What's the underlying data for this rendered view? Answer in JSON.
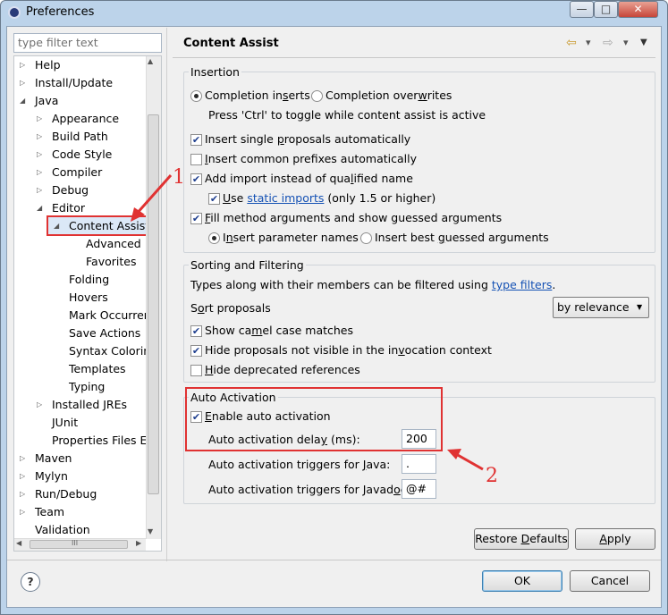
{
  "window": {
    "title": "Preferences",
    "min_glyph": "—",
    "max_glyph": "□",
    "close_glyph": "✕"
  },
  "left": {
    "filter_placeholder": "type filter text",
    "tree": [
      {
        "label": "Help",
        "level": 0,
        "arrow": "▷"
      },
      {
        "label": "Install/Update",
        "level": 0,
        "arrow": "▷"
      },
      {
        "label": "Java",
        "level": 0,
        "arrow": "◢"
      },
      {
        "label": "Appearance",
        "level": 1,
        "arrow": "▷"
      },
      {
        "label": "Build Path",
        "level": 1,
        "arrow": "▷"
      },
      {
        "label": "Code Style",
        "level": 1,
        "arrow": "▷"
      },
      {
        "label": "Compiler",
        "level": 1,
        "arrow": "▷"
      },
      {
        "label": "Debug",
        "level": 1,
        "arrow": "▷"
      },
      {
        "label": "Editor",
        "level": 1,
        "arrow": "◢"
      },
      {
        "label": "Content Assist",
        "level": 2,
        "arrow": "◢",
        "selected": true
      },
      {
        "label": "Advanced",
        "level": 3,
        "arrow": ""
      },
      {
        "label": "Favorites",
        "level": 3,
        "arrow": ""
      },
      {
        "label": "Folding",
        "level": 2,
        "arrow": ""
      },
      {
        "label": "Hovers",
        "level": 2,
        "arrow": ""
      },
      {
        "label": "Mark Occurren",
        "level": 2,
        "arrow": ""
      },
      {
        "label": "Save Actions",
        "level": 2,
        "arrow": ""
      },
      {
        "label": "Syntax Coloring",
        "level": 2,
        "arrow": ""
      },
      {
        "label": "Templates",
        "level": 2,
        "arrow": ""
      },
      {
        "label": "Typing",
        "level": 2,
        "arrow": ""
      },
      {
        "label": "Installed JREs",
        "level": 1,
        "arrow": "▷"
      },
      {
        "label": "JUnit",
        "level": 1,
        "arrow": ""
      },
      {
        "label": "Properties Files Ed",
        "level": 1,
        "arrow": ""
      },
      {
        "label": "Maven",
        "level": 0,
        "arrow": "▷"
      },
      {
        "label": "Mylyn",
        "level": 0,
        "arrow": "▷"
      },
      {
        "label": "Run/Debug",
        "level": 0,
        "arrow": "▷"
      },
      {
        "label": "Team",
        "level": 0,
        "arrow": "▷"
      },
      {
        "label": "Validation",
        "level": 0,
        "arrow": ""
      }
    ],
    "hscroll_glyph": "III"
  },
  "right": {
    "title": "Content Assist",
    "nav_back": "⇦",
    "nav_back_menu": "▾",
    "nav_forward": "⇨",
    "nav_forward_menu": "▾",
    "view_menu": "▼",
    "insertion": {
      "title": "Insertion",
      "radio_inserts": {
        "pre": "Completion in",
        "u": "s",
        "post": "erts"
      },
      "radio_overwrites": {
        "pre": "Completion over",
        "u": "w",
        "post": "rites"
      },
      "toggle_hint": "Press 'Ctrl' to toggle while content assist is active",
      "single_proposals": {
        "pre": "Insert single ",
        "u": "p",
        "post": "roposals automatically"
      },
      "common_prefixes": {
        "pre": "",
        "u": "I",
        "post": "nsert common prefixes automatically"
      },
      "add_import": {
        "pre": "Add import instead of qua",
        "u": "l",
        "post": "ified name"
      },
      "use_static": {
        "pre": "",
        "u": "U",
        "post": "se ",
        "link": "static imports",
        "tail": " (only 1.5 or higher)"
      },
      "fill_args": {
        "pre": "",
        "u": "F",
        "post": "ill method arguments and show guessed arguments"
      },
      "insert_param": {
        "pre": "I",
        "u": "n",
        "post": "sert parameter names"
      },
      "insert_guessed": {
        "pre": "Insert best ",
        "u": "g",
        "post": "uessed arguments"
      }
    },
    "sorting": {
      "title": "Sorting and Filtering",
      "types_text": "Types along with their members can be filtered using ",
      "types_link": "type filters",
      "types_tail": ".",
      "sort_label": {
        "pre": "S",
        "u": "o",
        "post": "rt proposals"
      },
      "sort_value": "by relevance",
      "sort_arrow": "▼",
      "camel": {
        "pre": "Show ca",
        "u": "m",
        "post": "el case matches"
      },
      "hide_invocation": {
        "pre": "Hide proposals not visible in the in",
        "u": "v",
        "post": "ocation context"
      },
      "hide_deprecated": {
        "pre": "",
        "u": "H",
        "post": "ide deprecated references"
      }
    },
    "auto": {
      "title": "Auto Activation",
      "enable": {
        "pre": "",
        "u": "E",
        "post": "nable auto activation"
      },
      "delay_label": {
        "pre": "Auto activation dela",
        "u": "y",
        "post": " (ms):"
      },
      "delay_value": "200",
      "java_label": {
        "pre": "Auto activation triggers for ",
        "u": "J",
        "post": "ava:"
      },
      "java_value": ".",
      "javadoc_label": {
        "pre": "Auto activation triggers for Javad",
        "u": "o",
        "post": "c:"
      },
      "javadoc_value": "@#"
    },
    "restore_defaults": {
      "pre": "Restore ",
      "u": "D",
      "post": "efaults"
    },
    "apply": {
      "pre": "",
      "u": "A",
      "post": "pply"
    }
  },
  "footer": {
    "help": "?",
    "ok": "OK",
    "cancel": "Cancel"
  },
  "annotations": {
    "one": "1",
    "two": "2"
  },
  "colors": {
    "highlight": "#e03232",
    "link": "#1451b4",
    "selection": "#dbe8f7"
  }
}
